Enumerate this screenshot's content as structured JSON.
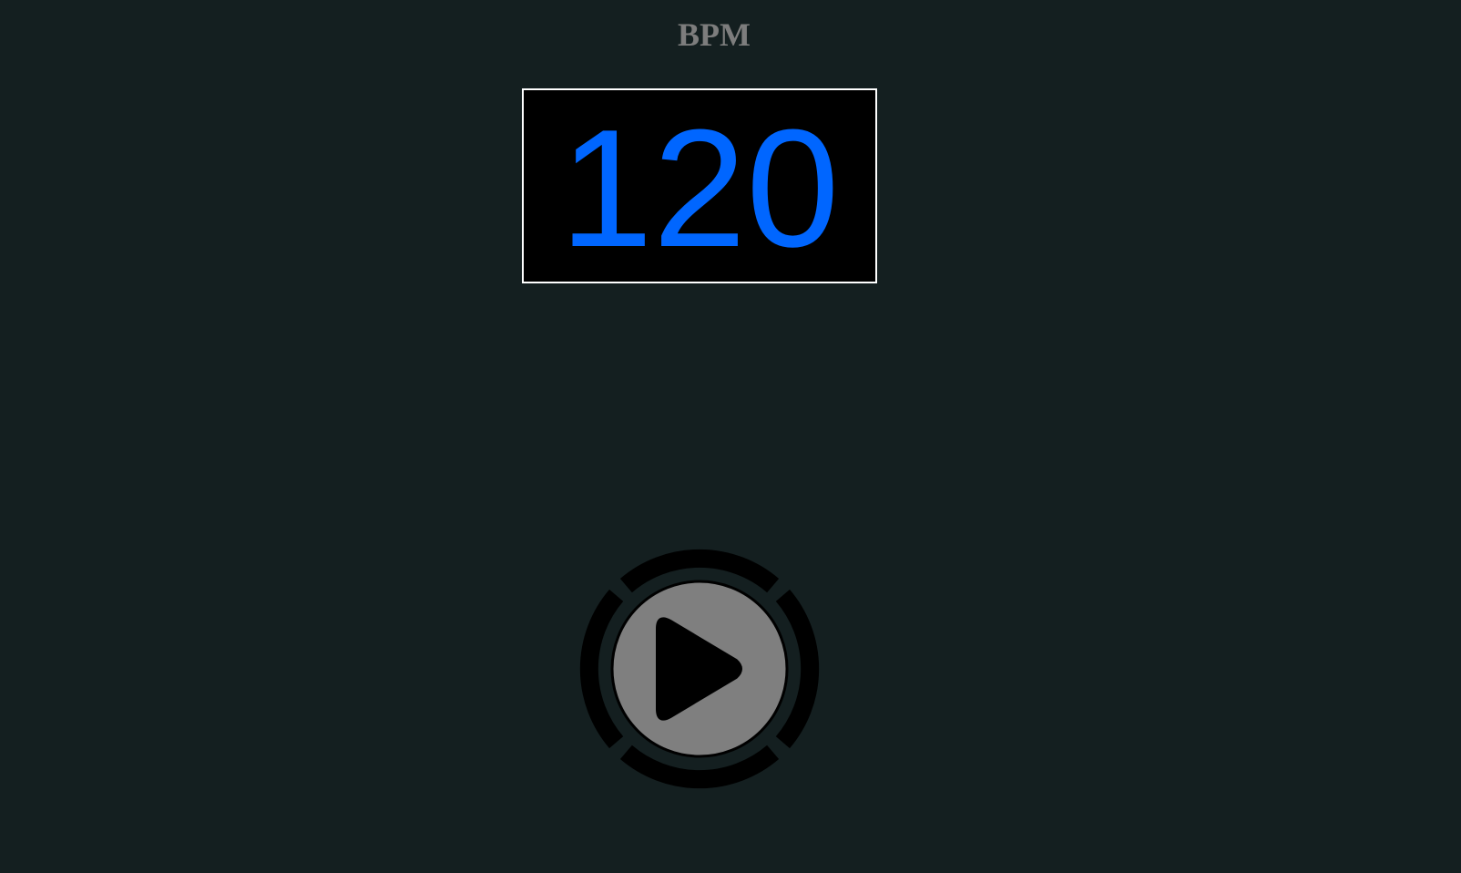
{
  "header": {
    "title": "BPM"
  },
  "tempo": {
    "value": "120"
  },
  "transport": {
    "play_icon": "play-icon",
    "ring_icon": "segmented-ring-icon"
  },
  "colors": {
    "background": "#141f20",
    "title": "#7d7d7d",
    "display_bg": "#000000",
    "display_border": "#ffffff",
    "display_digits": "#0066ff",
    "button_face": "#7f7f7f",
    "ring": "#000000"
  }
}
